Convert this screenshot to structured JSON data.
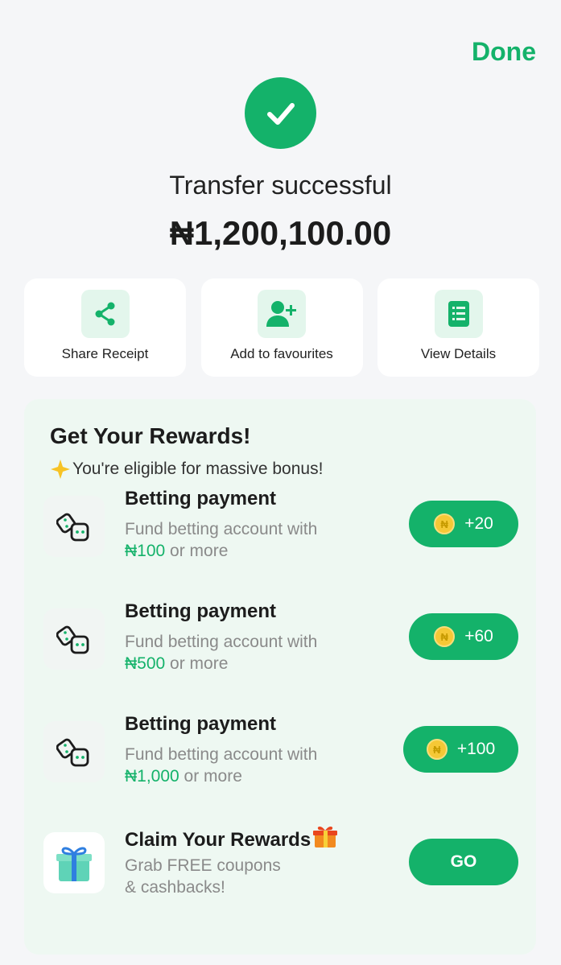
{
  "header": {
    "done_label": "Done"
  },
  "status": {
    "title": "Transfer successful",
    "amount": "₦1,200,100.00"
  },
  "actions": [
    {
      "label": "Share Receipt",
      "icon": "share-icon"
    },
    {
      "label": "Add to favourites",
      "icon": "add-user-icon"
    },
    {
      "label": "View Details",
      "icon": "list-icon"
    }
  ],
  "rewards": {
    "title": "Get Your Rewards!",
    "subtitle": "You're eligible for massive bonus!",
    "items": [
      {
        "title": "Betting payment",
        "desc_prefix": "Fund betting account with",
        "amount": "₦100",
        "desc_suffix": " or more",
        "coin": "₦",
        "reward": "+20"
      },
      {
        "title": "Betting payment",
        "desc_prefix": "Fund betting account with",
        "amount": "₦500",
        "desc_suffix": " or more",
        "coin": "₦",
        "reward": "+60"
      },
      {
        "title": "Betting payment",
        "desc_prefix": "Fund betting account with",
        "amount": "₦1,000",
        "desc_suffix": " or more",
        "coin": "₦",
        "reward": "+100"
      }
    ],
    "claim": {
      "title": "Claim Your Rewards",
      "desc_line1": "Grab FREE coupons",
      "desc_line2": "& cashbacks!",
      "button": "GO"
    }
  },
  "colors": {
    "accent": "#14b26a",
    "background": "#f5f6f8",
    "panel": "#eef8f2"
  }
}
